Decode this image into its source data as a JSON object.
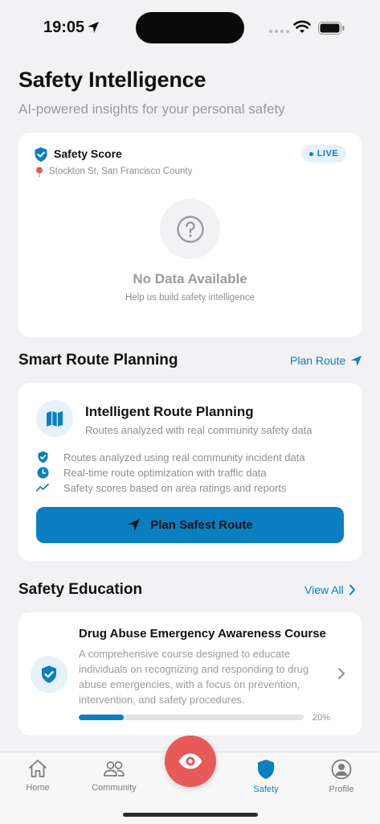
{
  "status_bar": {
    "time": "19:05"
  },
  "header": {
    "title": "Safety Intelligence",
    "subtitle": "AI-powered insights for your personal safety"
  },
  "safety_score": {
    "title": "Safety Score",
    "badge": "LIVE",
    "location": "Stockton St, San Francisco County",
    "empty_title": "No Data Available",
    "empty_subtitle": "Help us build safety intelligence"
  },
  "route_section": {
    "title": "Smart Route Planning",
    "link": "Plan Route",
    "card_title": "Intelligent Route Planning",
    "card_subtitle": "Routes analyzed with real community safety data",
    "features": [
      {
        "icon": "shield-check-icon",
        "text": "Routes analyzed using real community incident data"
      },
      {
        "icon": "clock-icon",
        "text": "Real-time route optimization with traffic data"
      },
      {
        "icon": "trend-icon",
        "text": "Safety scores based on area ratings and reports"
      }
    ],
    "button": "Plan Safest Route"
  },
  "education_section": {
    "title": "Safety Education",
    "link": "View All",
    "course": {
      "title": "Drug Abuse Emergency Awareness Course",
      "description": "A comprehensive course designed to educate individuals on recognizing and responding to drug abuse emergencies, with a focus on prevention, intervention, and safety procedures.",
      "progress": 0.2,
      "progress_label": "20%"
    }
  },
  "tab_bar": {
    "tabs": [
      {
        "label": "Home",
        "icon": "home-icon"
      },
      {
        "label": "Community",
        "icon": "people-icon"
      },
      {
        "label": "Safety",
        "icon": "shield-icon",
        "active": true
      },
      {
        "label": "Profile",
        "icon": "profile-icon"
      }
    ],
    "center_button_icon": "eye-icon"
  },
  "colors": {
    "accent": "#0b7ec2",
    "accent_light": "#e6f1f9",
    "danger": "#e65a5a",
    "background": "#f2f2f4"
  }
}
